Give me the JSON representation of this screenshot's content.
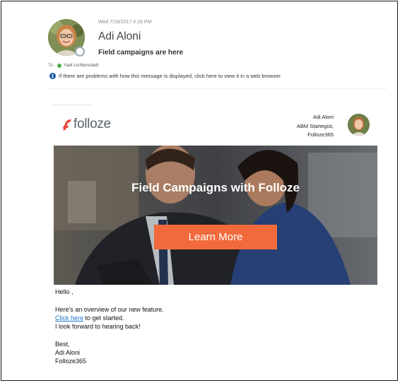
{
  "email": {
    "date": "Wed 7/19/2017 4:18 PM",
    "sender": "Adi Aloni",
    "subject": "Field campaigns are here",
    "to_label": "To",
    "recipient": "Yael Lichtenstadt",
    "info_message": "If there are problems with how this message is displayed, click here to view it in a web browser."
  },
  "newsletter": {
    "logo_text": "folloze",
    "author_name": "Adi Aloni",
    "author_title": "ABM Startegist,",
    "author_company": "Folloze365",
    "hero_title": "Field Campaigns with Folloze",
    "hero_button": "Learn More",
    "greeting": "Hello ,",
    "intro": "Here's an overview of our new feature.",
    "link_text": "Click here",
    "link_suffix": " to get started.",
    "closing_line": "I look forward to hearing back!",
    "signoff": "Best,",
    "signature_name": "Adi Aloni",
    "signature_company": "Folloze365"
  },
  "colors": {
    "accent": "#f26a3c",
    "link": "#1a73c8",
    "presence": "#4caf50"
  }
}
